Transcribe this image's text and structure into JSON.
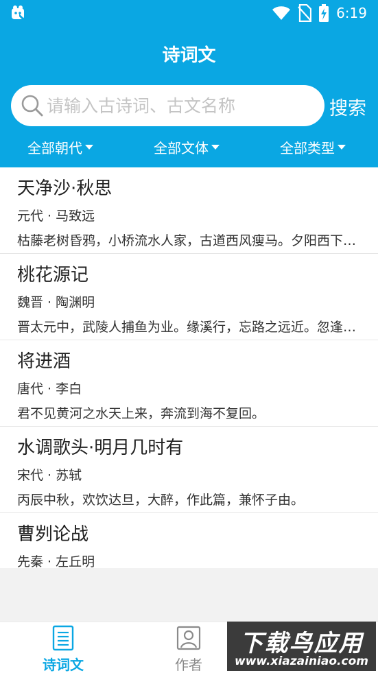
{
  "status_bar": {
    "time": "6:19",
    "icons": [
      "app-notification-icon",
      "wifi-icon",
      "no-sim-icon",
      "battery-charging-icon"
    ]
  },
  "header": {
    "title": "诗词文"
  },
  "search": {
    "placeholder": "请输入古诗词、古文名称",
    "value": "",
    "button_label": "搜索"
  },
  "filters": [
    {
      "label": "全部朝代"
    },
    {
      "label": "全部文体"
    },
    {
      "label": "全部类型"
    }
  ],
  "items": [
    {
      "title": "天净沙·秋思",
      "author": "元代 · 马致远",
      "excerpt": "枯藤老树昏鸦，小桥流水人家，古道西风瘦马。夕阳西下，断肠人在天涯。"
    },
    {
      "title": "桃花源记",
      "author": "魏晋 · 陶渊明",
      "excerpt": "晋太元中，武陵人捕鱼为业。缘溪行，忘路之远近。忽逢桃花林。"
    },
    {
      "title": "将进酒",
      "author": "唐代 · 李白",
      "excerpt": "君不见黄河之水天上来，奔流到海不复回。"
    },
    {
      "title": "水调歌头·明月几时有",
      "author": "宋代 · 苏轼",
      "excerpt": "丙辰中秋，欢饮达旦，大醉，作此篇，兼怀子由。"
    },
    {
      "title": "曹刿论战",
      "author": "先秦 · 左丘明",
      "excerpt": ""
    }
  ],
  "tabs": [
    {
      "label": "诗词文",
      "icon": "document-icon",
      "active": true
    },
    {
      "label": "作者",
      "icon": "person-icon",
      "active": false
    }
  ],
  "watermark": {
    "main": "下载鸟应用",
    "url": "www.xiazainiao.com"
  },
  "colors": {
    "primary": "#0aa7e3",
    "background": "#f2f2f2",
    "text": "#222222"
  }
}
